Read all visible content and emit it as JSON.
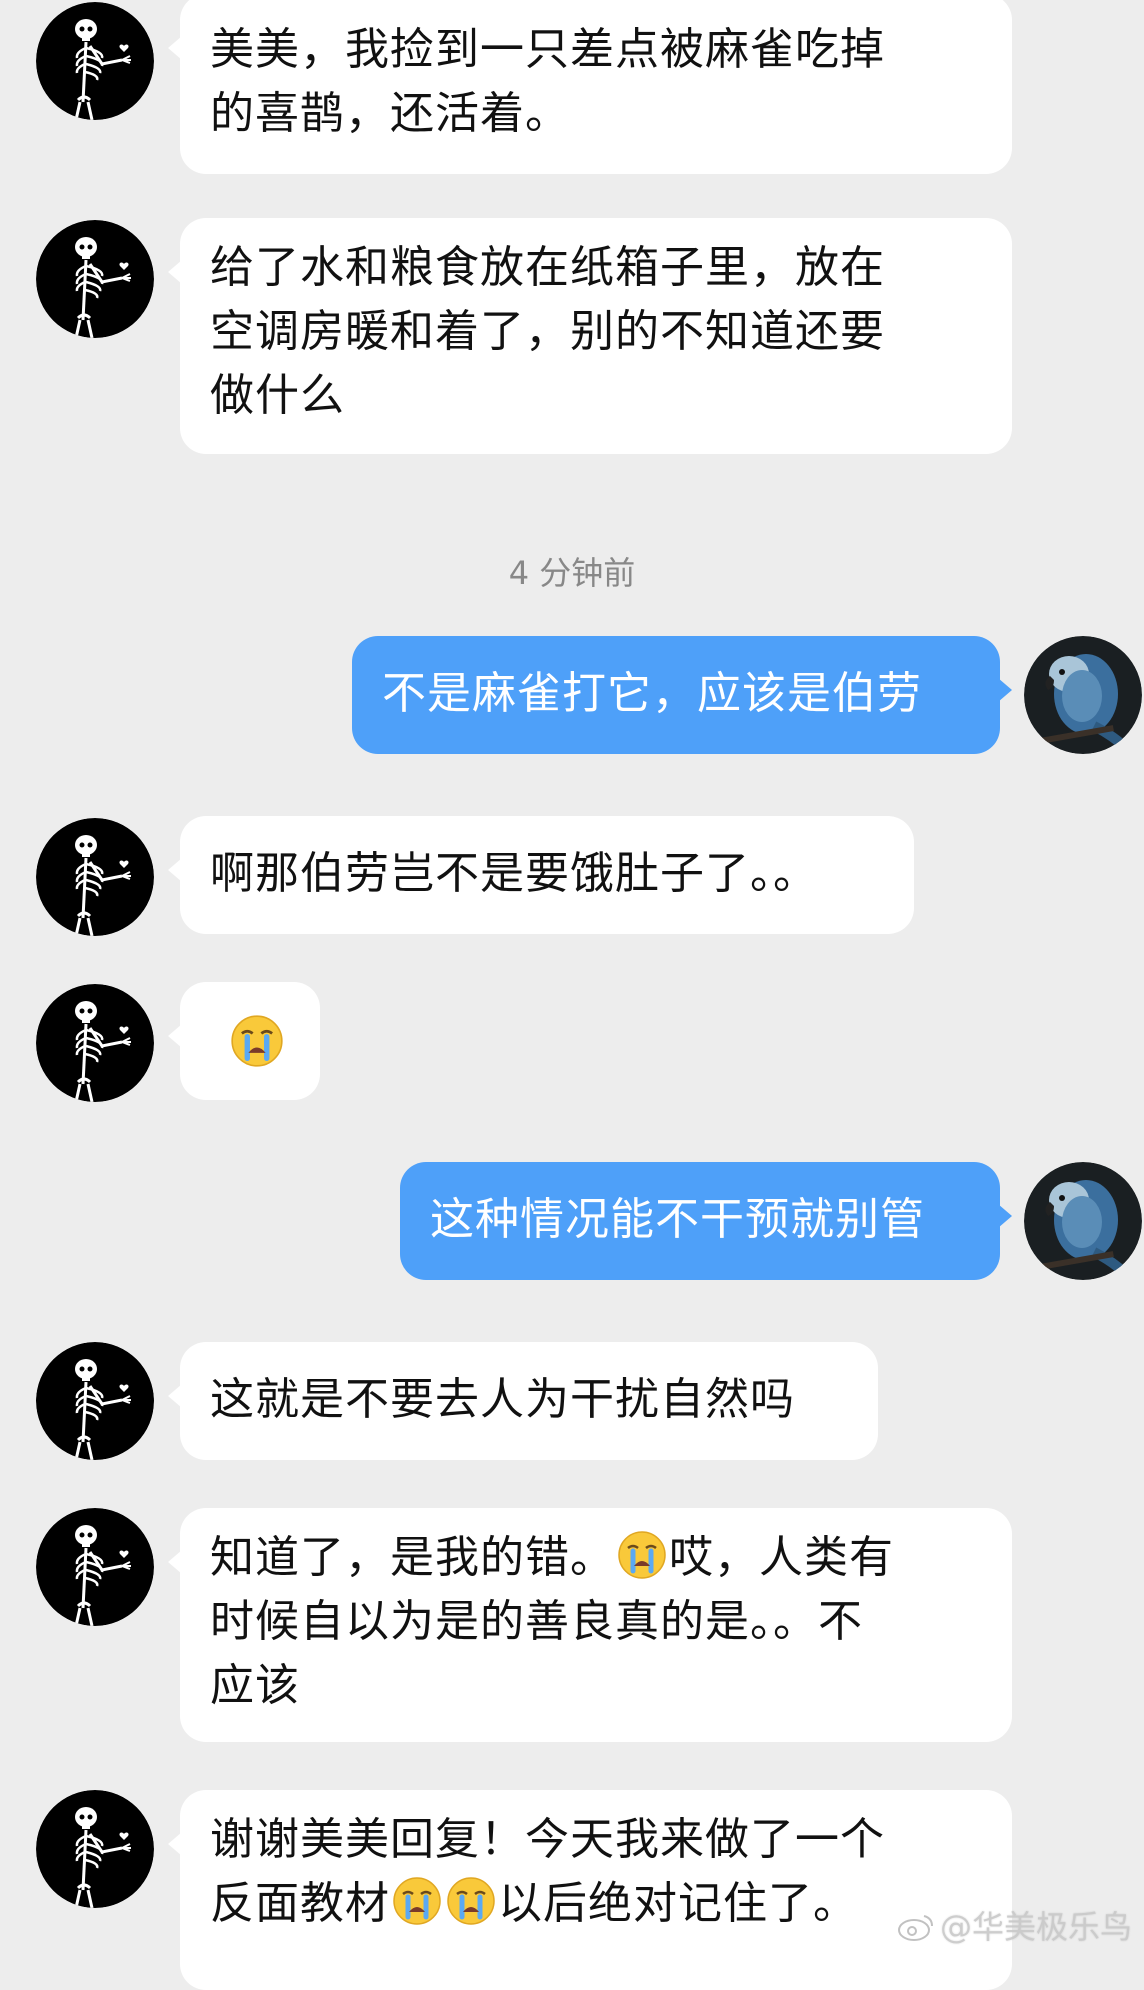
{
  "messages": [
    {
      "side": "in",
      "lines": [
        "美美，我捡到一只差点被麻雀吃掉",
        "的喜鹊，还活着。"
      ]
    },
    {
      "side": "in",
      "lines": [
        "给了水和粮食放在纸箱子里，放在",
        "空调房暖和着了，别的不知道还要",
        "做什么"
      ]
    },
    {
      "time": "4 分钟前"
    },
    {
      "side": "out",
      "lines": [
        "不是麻雀打它，应该是伯劳"
      ]
    },
    {
      "side": "in",
      "lines": [
        "啊那伯劳岂不是要饿肚子了。。"
      ]
    },
    {
      "side": "in",
      "emoji": "loudly-crying-face"
    },
    {
      "side": "out",
      "lines": [
        "这种情况能不干预就别管"
      ]
    },
    {
      "side": "in",
      "lines": [
        "这就是不要去人为干扰自然吗"
      ]
    },
    {
      "side": "in",
      "line1_a": "知道了，是我的错。",
      "line1_b": "哎，人类有",
      "lines_rest": [
        "时候自以为是的善良真的是。。不",
        "应该"
      ]
    },
    {
      "side": "in",
      "line1": "谢谢美美回复！今天我来做了一个",
      "line2_a": "反面教材",
      "line2_b": "以后绝对记住了。"
    }
  ],
  "watermark": "@华美极乐鸟",
  "colors": {
    "background": "#ededed",
    "incoming_bubble": "#ffffff",
    "outgoing_bubble": "#4ea0f9",
    "timestamp": "#888888"
  },
  "icons": {
    "incoming_avatar": "skeleton-avatar-icon",
    "outgoing_avatar": "blue-parrot-avatar-icon",
    "emoji": "loudly-crying-face-icon"
  }
}
